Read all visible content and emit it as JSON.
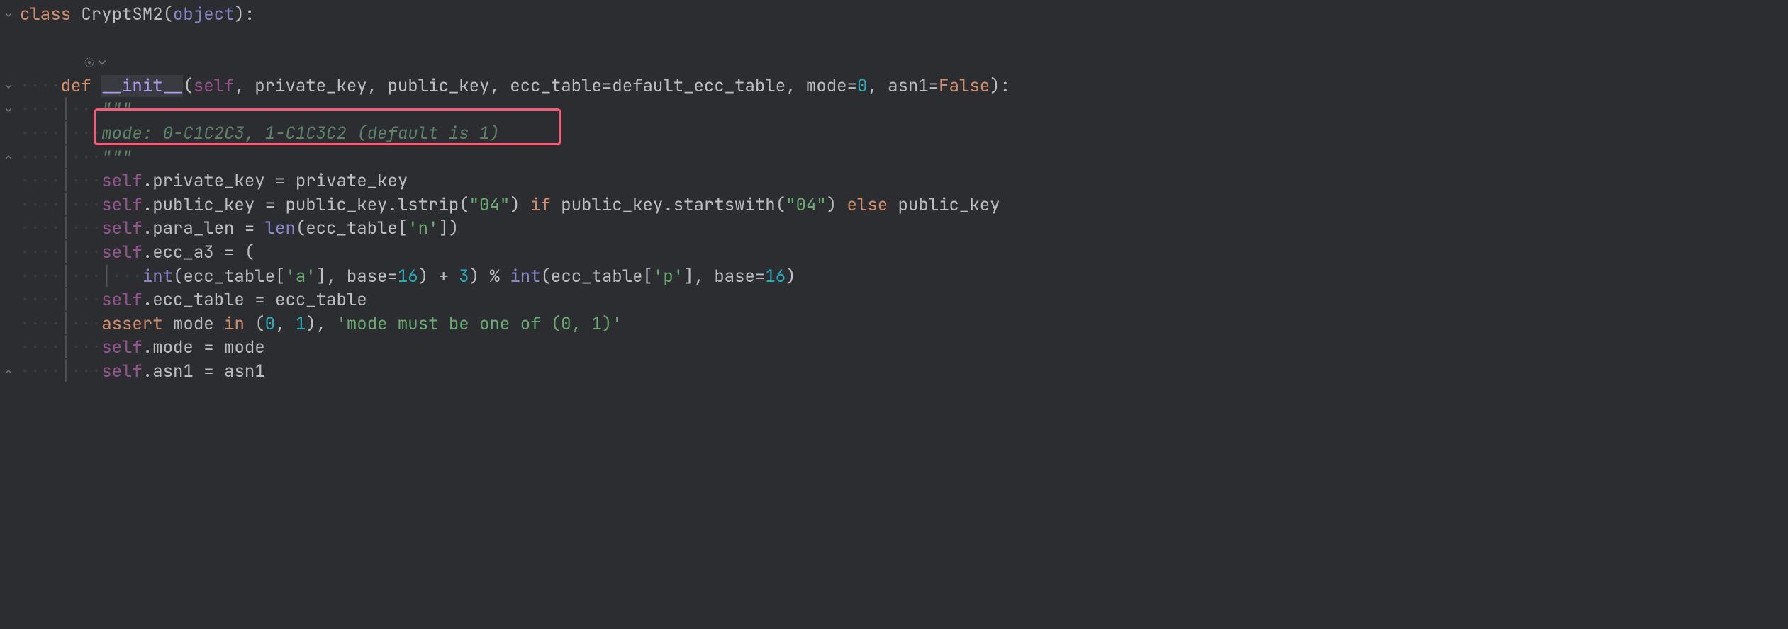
{
  "code": {
    "class_kw": "class",
    "class_name": "CryptSM2",
    "object_builtin": "object",
    "def_kw": "def",
    "init_name": "__init__",
    "self_kw": "self",
    "param_private_key": "private_key",
    "param_public_key": "public_key",
    "param_ecc_table": "ecc_table",
    "param_default_ecc": "default_ecc_table",
    "param_mode": "mode",
    "mode_default": "0",
    "param_asn1": "asn1",
    "asn1_default": "False",
    "docstr_open": "\"\"\"",
    "docstr_line": "mode: 0-C1C2C3, 1-C1C3C2 (default is 1)",
    "docstr_close": "\"\"\"",
    "attr_private_key": "private_key",
    "attr_public_key": "public_key",
    "lstrip_call": "lstrip",
    "str_04_1": "\"04\"",
    "if_kw": "if",
    "startswith_call": "startswith",
    "str_04_2": "\"04\"",
    "else_kw": "else",
    "attr_para_len": "para_len",
    "len_call": "len",
    "str_n": "'n'",
    "attr_ecc_a3": "ecc_a3",
    "int_call": "int",
    "str_a": "'a'",
    "base_kw": "base",
    "base_16_1": "16",
    "plus_3": "3",
    "str_p": "'p'",
    "base_16_2": "16",
    "attr_ecc_table": "ecc_table",
    "assert_kw": "assert",
    "in_kw": "in",
    "tuple_0": "0",
    "tuple_1": "1",
    "assert_msg": "'mode must be one of (0, 1)'",
    "attr_mode": "mode",
    "attr_asn1": "asn1"
  },
  "icons": {
    "fold_open": "⌄",
    "fold_close": "⌃"
  }
}
